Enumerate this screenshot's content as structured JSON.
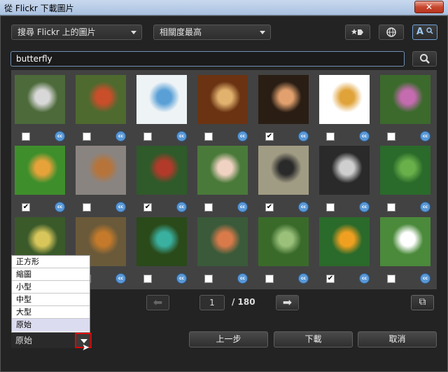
{
  "window": {
    "title": "從 Flickr 下載圖片",
    "close_label": "✕"
  },
  "toolbar": {
    "source_dropdown": "搜尋 Flickr 上的圖片",
    "sort_dropdown": "相關度最高",
    "tag_button_icon": "star-tag-icon",
    "globe_button_icon": "globe-icon",
    "text_search_button": "A",
    "text_search_icon": "text-search-icon"
  },
  "search": {
    "value": "butterfly"
  },
  "images": [
    {
      "checked": false,
      "colors": [
        "#4d6a3a",
        "#d8d8d8"
      ]
    },
    {
      "checked": false,
      "colors": [
        "#4e6a2f",
        "#c94e2a"
      ]
    },
    {
      "checked": false,
      "colors": [
        "#eef3f6",
        "#5aa0d6"
      ]
    },
    {
      "checked": false,
      "colors": [
        "#6b3312",
        "#e1b26e"
      ]
    },
    {
      "checked": true,
      "colors": [
        "#2a1e14",
        "#e1a06d"
      ]
    },
    {
      "checked": false,
      "colors": [
        "#ffffff",
        "#e0a33a"
      ]
    },
    {
      "checked": false,
      "colors": [
        "#3b6a2c",
        "#c56bb0"
      ]
    },
    {
      "checked": true,
      "colors": [
        "#3e8f2c",
        "#e8a23a"
      ]
    },
    {
      "checked": false,
      "colors": [
        "#8a8480",
        "#b7743a"
      ]
    },
    {
      "checked": true,
      "colors": [
        "#2f5a2a",
        "#b23a2a"
      ]
    },
    {
      "checked": false,
      "colors": [
        "#4a7a3a",
        "#f0d2c2"
      ]
    },
    {
      "checked": true,
      "colors": [
        "#a09b83",
        "#2a2a2a"
      ]
    },
    {
      "checked": false,
      "colors": [
        "#2a2a2a",
        "#cfcfcf"
      ]
    },
    {
      "checked": false,
      "colors": [
        "#2a6a2a",
        "#6ab04a"
      ]
    },
    {
      "checked": false,
      "colors": [
        "#3a5a2a",
        "#d8c65a"
      ]
    },
    {
      "checked": false,
      "colors": [
        "#6a5a3a",
        "#c47a2a"
      ]
    },
    {
      "checked": false,
      "colors": [
        "#2a4a1a",
        "#3ab0a0"
      ]
    },
    {
      "checked": false,
      "colors": [
        "#3a5a3a",
        "#d87a4a"
      ]
    },
    {
      "checked": false,
      "colors": [
        "#3a6a2a",
        "#9ac07a"
      ]
    },
    {
      "checked": true,
      "colors": [
        "#2a6a2a",
        "#f0a020"
      ]
    },
    {
      "checked": false,
      "colors": [
        "#4a8a3a",
        "#ffffff"
      ]
    }
  ],
  "cc_label": "cc",
  "pager": {
    "page": "1",
    "total": "/ 180",
    "prev_icon": "arrow-left-icon",
    "next_icon": "arrow-right-icon",
    "expand_icon": "expand-icon"
  },
  "size": {
    "selected": "原始",
    "options": [
      "正方形",
      "縮圖",
      "小型",
      "中型",
      "大型",
      "原始"
    ]
  },
  "buttons": {
    "back": "上一步",
    "download": "下載",
    "cancel": "取消"
  }
}
